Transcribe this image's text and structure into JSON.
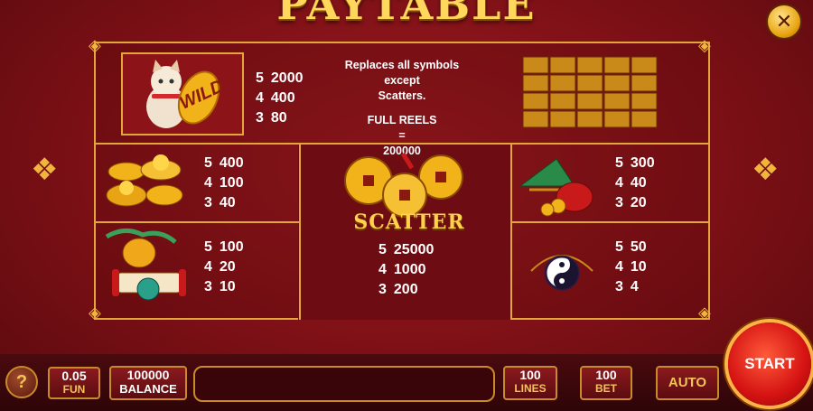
{
  "title": "PAYTABLE",
  "close_label": "✕",
  "wild": {
    "symbol": "WILD",
    "pays": [
      {
        "n": "5",
        "v": "2000"
      },
      {
        "n": "4",
        "v": "400"
      },
      {
        "n": "3",
        "v": "80"
      }
    ],
    "description_line1": "Replaces all symbols except",
    "description_line2": "Scatters.",
    "full_reels_label": "FULL REELS",
    "equals": "=",
    "full_reels_value": "200000"
  },
  "gold": {
    "pays": [
      {
        "n": "5",
        "v": "400"
      },
      {
        "n": "4",
        "v": "100"
      },
      {
        "n": "3",
        "v": "40"
      }
    ]
  },
  "teapot": {
    "pays": [
      {
        "n": "5",
        "v": "100"
      },
      {
        "n": "4",
        "v": "20"
      },
      {
        "n": "3",
        "v": "10"
      }
    ]
  },
  "scatter": {
    "label": "SCATTER",
    "pays": [
      {
        "n": "5",
        "v": "25000"
      },
      {
        "n": "4",
        "v": "1000"
      },
      {
        "n": "3",
        "v": "200"
      }
    ]
  },
  "fan": {
    "pays": [
      {
        "n": "5",
        "v": "300"
      },
      {
        "n": "4",
        "v": "40"
      },
      {
        "n": "3",
        "v": "20"
      }
    ]
  },
  "yinyang": {
    "pays": [
      {
        "n": "5",
        "v": "50"
      },
      {
        "n": "4",
        "v": "10"
      },
      {
        "n": "3",
        "v": "4"
      }
    ]
  },
  "bottom": {
    "help_label": "?",
    "coin_value": "0.05",
    "coin_label": "FUN",
    "balance_value": "100000",
    "balance_label": "BALANCE",
    "lines_value": "100",
    "lines_label": "LINES",
    "bet_value": "100",
    "bet_label": "BET",
    "auto_label": "AUTO",
    "start_label": "START"
  },
  "colors": {
    "gold": "#e3a63a",
    "red": "#7c1016",
    "start": "#d41212"
  }
}
